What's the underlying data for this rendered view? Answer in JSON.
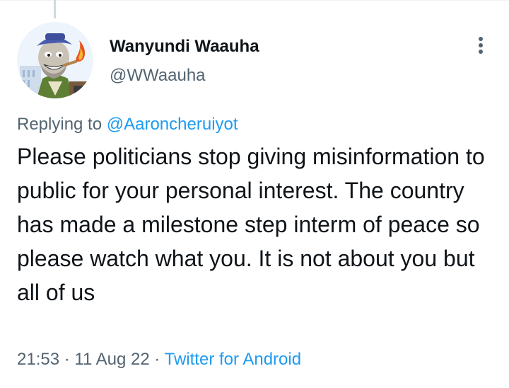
{
  "tweet": {
    "author": {
      "display_name": "Wanyundi Waauha",
      "handle": "@WWaauha"
    },
    "reply_prefix": "Replying to ",
    "reply_mention": "@Aaroncheruiyot",
    "text": "Please politicians stop giving misinformation to public for your personal interest. The country has made a milestone step interm of peace so please watch what you. It is not about you but all of us",
    "time": "21:53",
    "separator": "·",
    "date": "11 Aug 22",
    "source": "Twitter for Android"
  },
  "icons": {
    "more": "more-vertical-icon",
    "avatar": "cartoon-caricature-avatar"
  },
  "colors": {
    "link": "#1d9bf0",
    "secondary_text": "#536471",
    "primary_text": "#0f1419",
    "background": "#ffffff"
  }
}
